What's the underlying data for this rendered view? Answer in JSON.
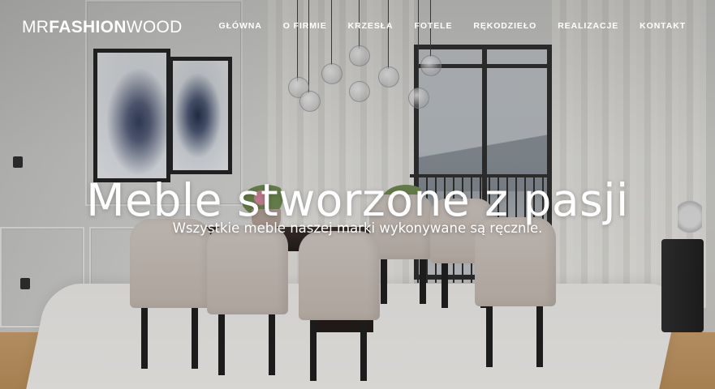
{
  "logo": {
    "part_light": "MR",
    "part_bold": "FASHION",
    "part_end": "WOOD"
  },
  "nav": {
    "items": [
      {
        "label": "GŁÓWNA"
      },
      {
        "label": "O FIRMIE"
      },
      {
        "label": "KRZESŁA"
      },
      {
        "label": "FOTELE"
      },
      {
        "label": "RĘKODZIEŁO"
      },
      {
        "label": "REALIZACJE"
      },
      {
        "label": "KONTAKT"
      }
    ]
  },
  "hero": {
    "title": "Meble stworzone z pasji",
    "subtitle": "Wszystkie meble naszej marki wykonywane są ręcznie.",
    "image_description_icon": "dining-room-photo"
  },
  "colors": {
    "nav_text": "#ffffff",
    "hero_text": "#ffffff"
  }
}
